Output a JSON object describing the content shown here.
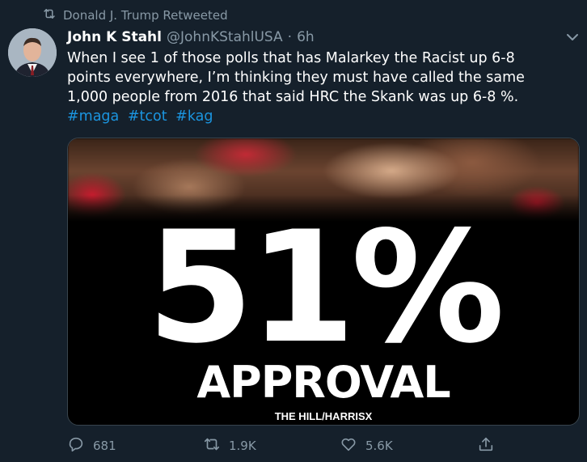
{
  "retweet": {
    "label": "Donald J. Trump Retweeted",
    "icon": "retweet-icon"
  },
  "tweet": {
    "author_name": "John K Stahl",
    "handle": "@JohnKStahlUSA",
    "separator": "·",
    "time": "6h",
    "text_lines": [
      "When I see 1 of those polls that has Malarkey the Racist up 6-8",
      "points everywhere, I’m thinking they must have called the same",
      "1,000 people from 2016 that said HRC the Skank was up 6-8 %."
    ],
    "hashtags": [
      "#maga",
      "#tcot",
      "#kag"
    ]
  },
  "media": {
    "headline_number": "51%",
    "headline_word": "APPROVAL",
    "source": "THE HILL/HARRISX"
  },
  "actions": {
    "reply_count": "681",
    "retweet_count": "1.9K",
    "like_count": "5.6K"
  },
  "colors": {
    "background": "#15202b",
    "secondary_text": "#8899a6",
    "link": "#1b95e0"
  }
}
